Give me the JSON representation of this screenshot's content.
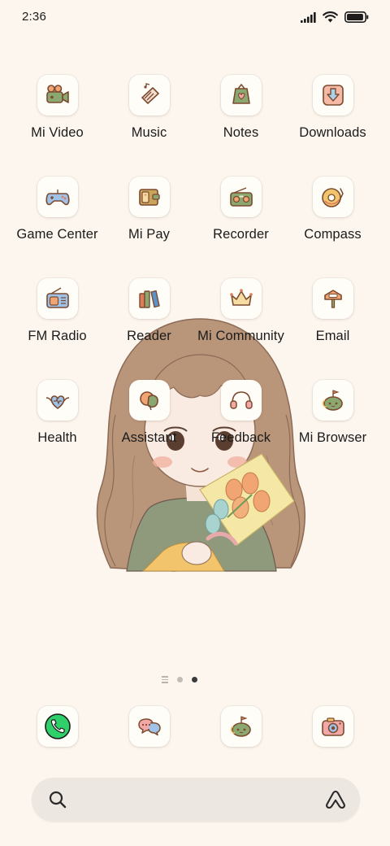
{
  "status_bar": {
    "time": "2:36",
    "icons": [
      "signal-icon",
      "wifi-icon",
      "battery-icon"
    ],
    "battery_level": 0.95
  },
  "apps": [
    {
      "label": "Mi Video",
      "icon": "video-camera-icon"
    },
    {
      "label": "Music",
      "icon": "music-icon"
    },
    {
      "label": "Notes",
      "icon": "notes-icon"
    },
    {
      "label": "Downloads",
      "icon": "download-icon"
    },
    {
      "label": "Game Center",
      "icon": "gamepad-icon"
    },
    {
      "label": "Mi Pay",
      "icon": "wallet-icon"
    },
    {
      "label": "Recorder",
      "icon": "recorder-icon"
    },
    {
      "label": "Compass",
      "icon": "compass-icon"
    },
    {
      "label": "FM Radio",
      "icon": "radio-icon"
    },
    {
      "label": "Reader",
      "icon": "books-icon"
    },
    {
      "label": "Mi Community",
      "icon": "crown-icon"
    },
    {
      "label": "Email",
      "icon": "mailbox-icon"
    },
    {
      "label": "Health",
      "icon": "heart-icon"
    },
    {
      "label": "Assistant",
      "icon": "assistant-icon"
    },
    {
      "label": "Feedback",
      "icon": "headphones-icon"
    },
    {
      "label": "Mi Browser",
      "icon": "browser-icon"
    }
  ],
  "page_indicator": {
    "pages": 2,
    "current_page": 2,
    "has_feed_page": true
  },
  "dock": [
    {
      "icon": "phone-icon"
    },
    {
      "icon": "messages-icon"
    },
    {
      "icon": "browser-icon"
    },
    {
      "icon": "camera-icon"
    }
  ],
  "search_bar": {
    "icons": [
      "search-icon",
      "assistant-triangle-icon"
    ]
  },
  "colors": {
    "background": "#fcf6ee",
    "tile": "#fffdf8",
    "search_bar": "#ece7e1",
    "phone_green": "#2fcf6a",
    "icon_outline": "#7b4a2f"
  }
}
